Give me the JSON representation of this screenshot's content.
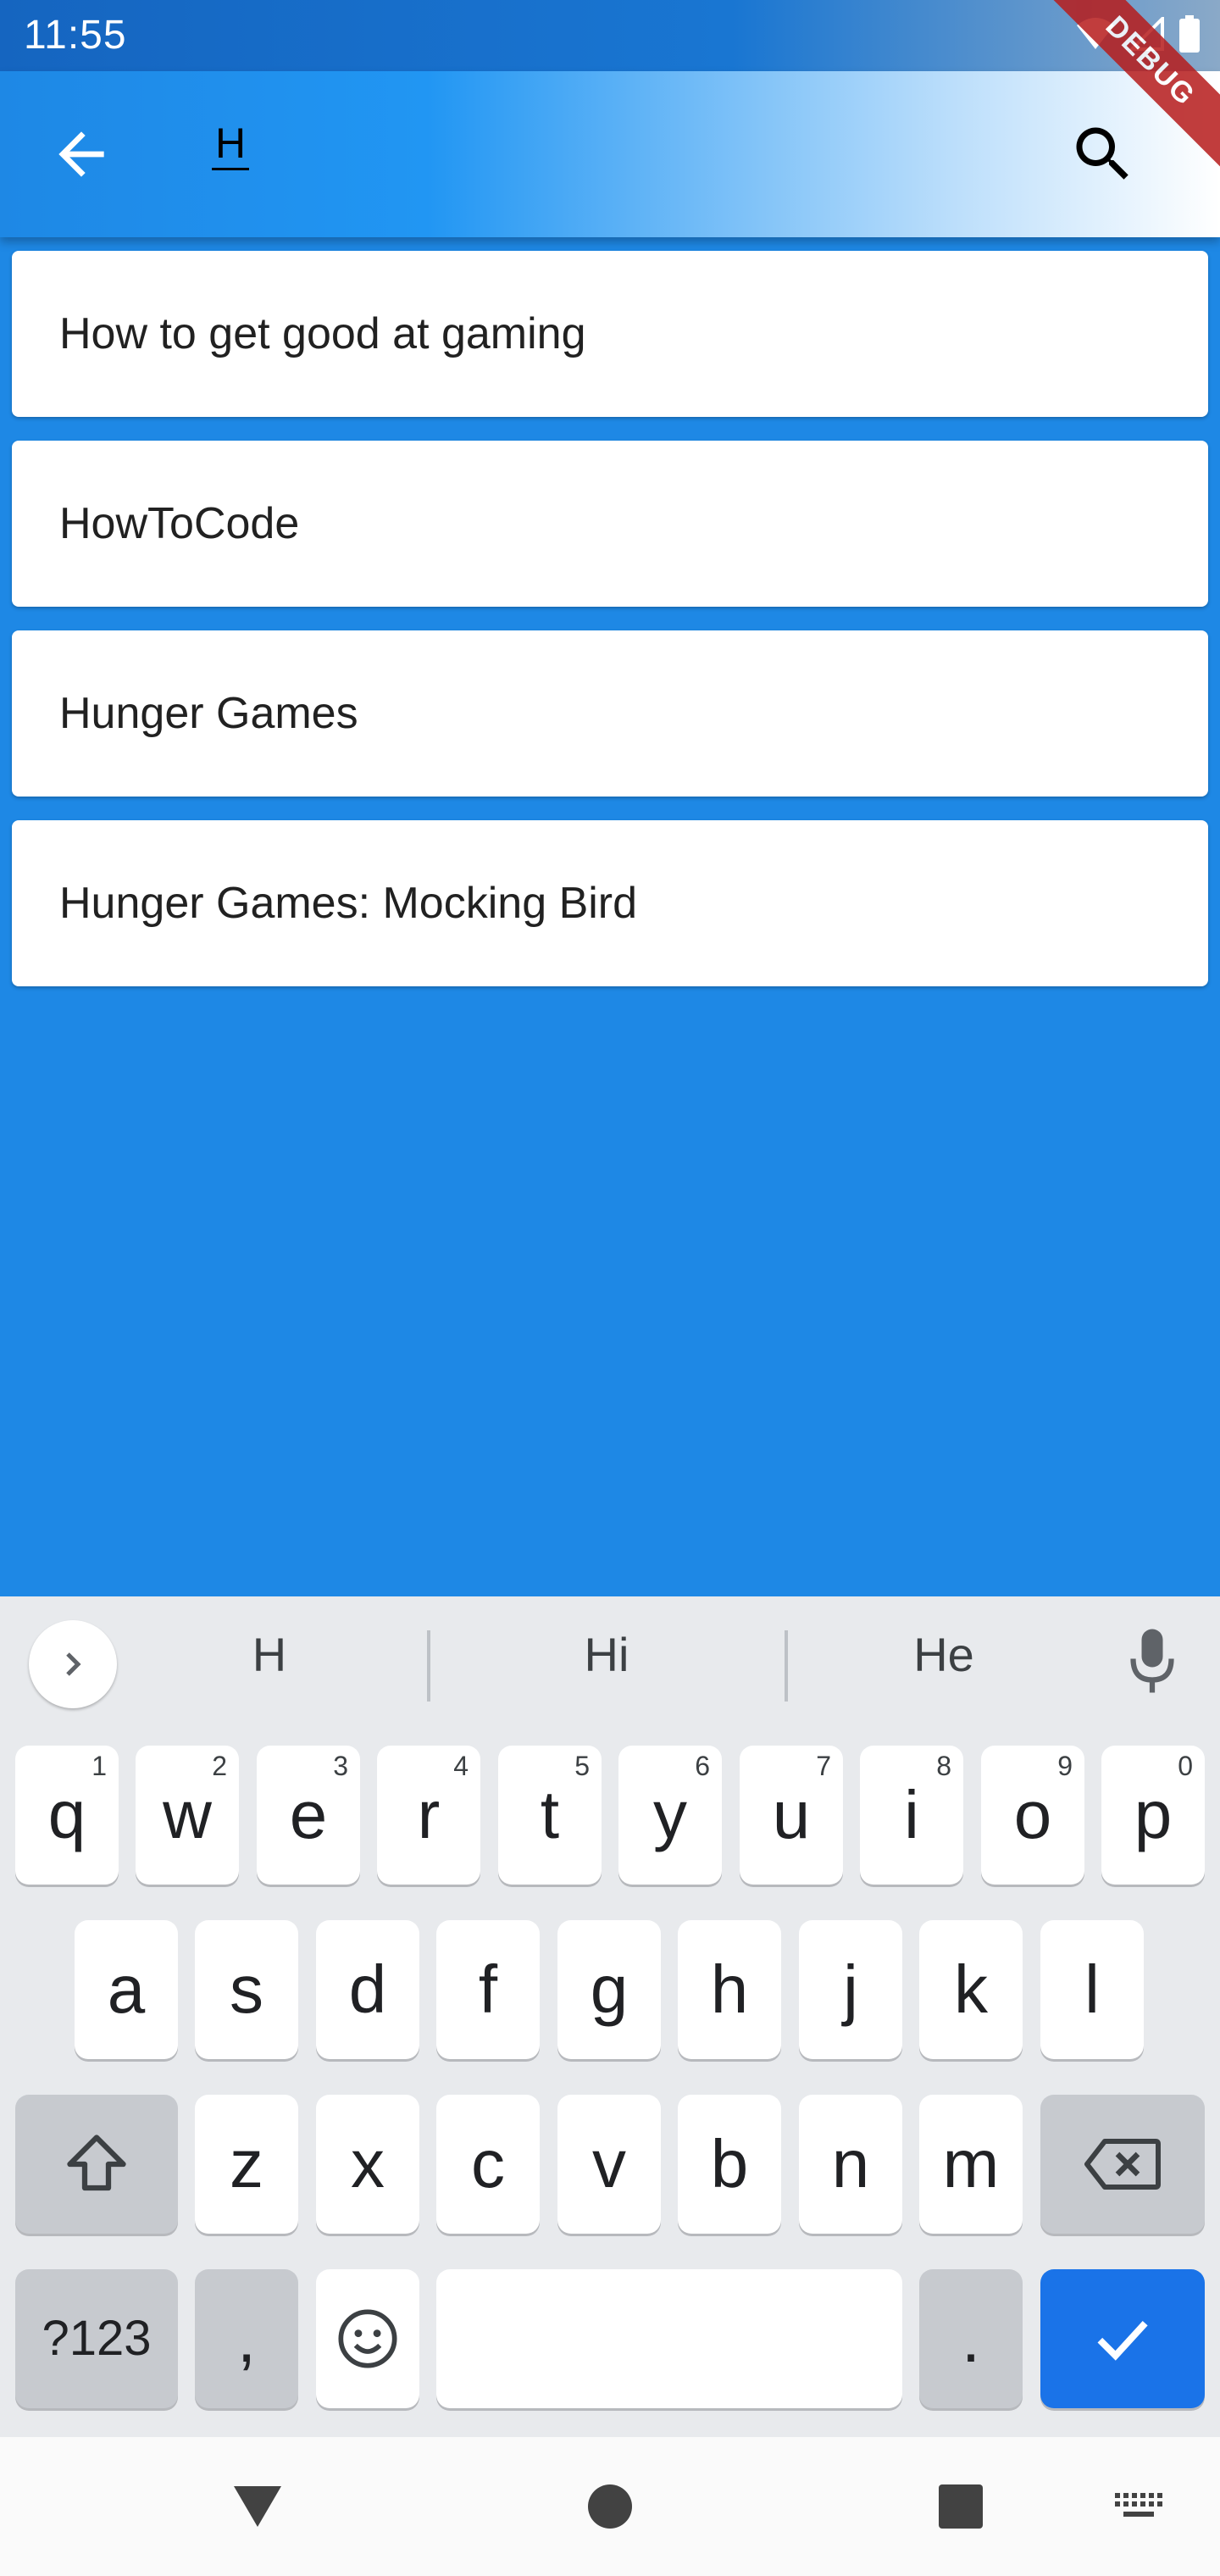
{
  "status_bar": {
    "time": "11:55"
  },
  "debug_banner": "DEBUG",
  "search": {
    "query": "H"
  },
  "results": [
    {
      "label": "How to get good at gaming"
    },
    {
      "label": "HowToCode"
    },
    {
      "label": "Hunger Games"
    },
    {
      "label": "Hunger Games: Mocking Bird"
    }
  ],
  "keyboard": {
    "suggestions": [
      "H",
      "Hi",
      "He"
    ],
    "row1": [
      {
        "key": "q",
        "num": "1"
      },
      {
        "key": "w",
        "num": "2"
      },
      {
        "key": "e",
        "num": "3"
      },
      {
        "key": "r",
        "num": "4"
      },
      {
        "key": "t",
        "num": "5"
      },
      {
        "key": "y",
        "num": "6"
      },
      {
        "key": "u",
        "num": "7"
      },
      {
        "key": "i",
        "num": "8"
      },
      {
        "key": "o",
        "num": "9"
      },
      {
        "key": "p",
        "num": "0"
      }
    ],
    "row2": [
      "a",
      "s",
      "d",
      "f",
      "g",
      "h",
      "j",
      "k",
      "l"
    ],
    "row3": [
      "z",
      "x",
      "c",
      "v",
      "b",
      "n",
      "m"
    ],
    "symbols_label": "?123",
    "comma": ",",
    "period": "."
  },
  "colors": {
    "background": "#1e88e5",
    "action_key": "#1a73e8"
  }
}
